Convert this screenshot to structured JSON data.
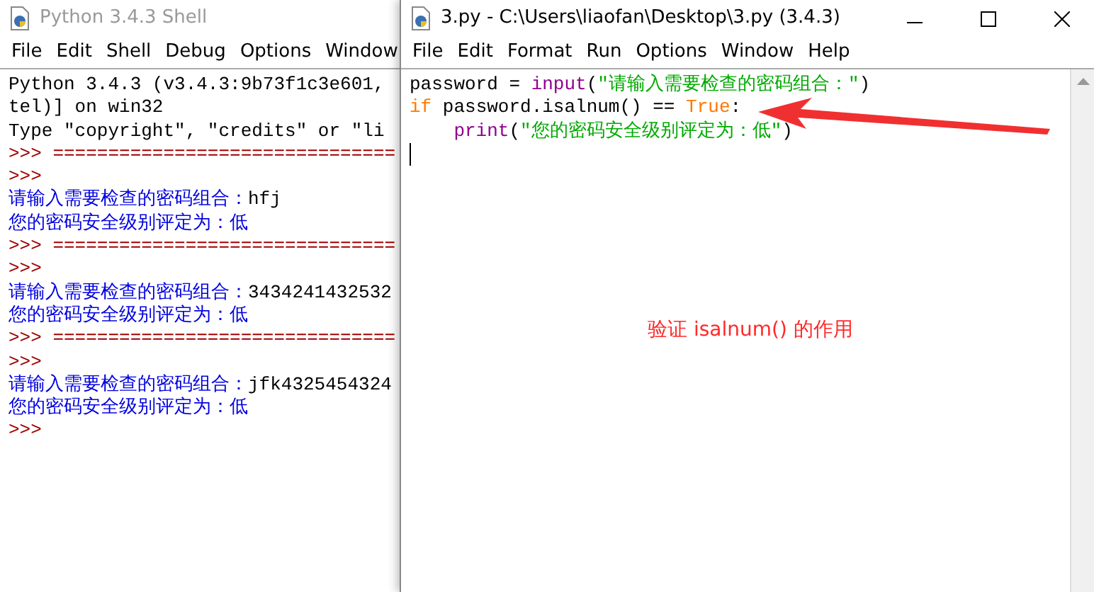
{
  "shell_window": {
    "title": "Python 3.4.3 Shell",
    "active": false,
    "menu": [
      "File",
      "Edit",
      "Shell",
      "Debug",
      "Options",
      "Window"
    ],
    "lines": [
      [
        {
          "kind": "output",
          "text": "Python 3.4.3 (v3.4.3:9b73f1c3e601,"
        }
      ],
      [
        {
          "kind": "output",
          "text": "tel)] on win32"
        }
      ],
      [
        {
          "kind": "output",
          "text": "Type \"copyright\", \"credits\" or \"li"
        }
      ],
      [
        {
          "kind": "prompt",
          "text": ">>> ==============================="
        }
      ],
      [
        {
          "kind": "prompt",
          "text": ">>>"
        }
      ],
      [
        {
          "kind": "stdout",
          "text": "请输入需要检查的密码组合："
        },
        {
          "kind": "input",
          "text": "hfj"
        }
      ],
      [
        {
          "kind": "stdout",
          "text": "您的密码安全级别评定为：低"
        }
      ],
      [
        {
          "kind": "prompt",
          "text": ">>> ==============================="
        }
      ],
      [
        {
          "kind": "prompt",
          "text": ">>>"
        }
      ],
      [
        {
          "kind": "stdout",
          "text": "请输入需要检查的密码组合："
        },
        {
          "kind": "input",
          "text": "3434241432532"
        }
      ],
      [
        {
          "kind": "stdout",
          "text": "您的密码安全级别评定为：低"
        }
      ],
      [
        {
          "kind": "prompt",
          "text": ">>> ==============================="
        }
      ],
      [
        {
          "kind": "prompt",
          "text": ">>>"
        }
      ],
      [
        {
          "kind": "stdout",
          "text": "请输入需要检查的密码组合："
        },
        {
          "kind": "input",
          "text": "jfk4325454324"
        }
      ],
      [
        {
          "kind": "stdout",
          "text": "您的密码安全级别评定为：低"
        }
      ],
      [
        {
          "kind": "prompt",
          "text": ">>>"
        }
      ]
    ]
  },
  "editor_window": {
    "title": "3.py - C:\\Users\\liaofan\\Desktop\\3.py (3.4.3)",
    "active": true,
    "menu": [
      {
        "label": "File"
      },
      {
        "label": "Edit"
      },
      {
        "label": "Format"
      },
      {
        "label": "Run"
      },
      {
        "label": "Options"
      },
      {
        "label": "Window"
      },
      {
        "label": "Help"
      }
    ],
    "code": [
      {
        "indented": false,
        "segments": [
          {
            "kind": "plain",
            "text": "password = "
          },
          {
            "kind": "builtin",
            "text": "input"
          },
          {
            "kind": "plain",
            "text": "("
          },
          {
            "kind": "string",
            "text": "\"请输入需要检查的密码组合：\""
          },
          {
            "kind": "plain",
            "text": ")"
          }
        ]
      },
      {
        "indented": false,
        "segments": [
          {
            "kind": "keyword",
            "text": "if"
          },
          {
            "kind": "plain",
            "text": " password.isalnum() == "
          },
          {
            "kind": "keyword",
            "text": "True"
          },
          {
            "kind": "plain",
            "text": ":"
          }
        ]
      },
      {
        "indented": true,
        "segments": [
          {
            "kind": "builtin",
            "text": "print"
          },
          {
            "kind": "plain",
            "text": "("
          },
          {
            "kind": "string",
            "text": "\"您的密码安全级别评定为：低\""
          },
          {
            "kind": "plain",
            "text": ")"
          }
        ]
      }
    ],
    "annotation": "验证 isalnum() 的作用"
  }
}
